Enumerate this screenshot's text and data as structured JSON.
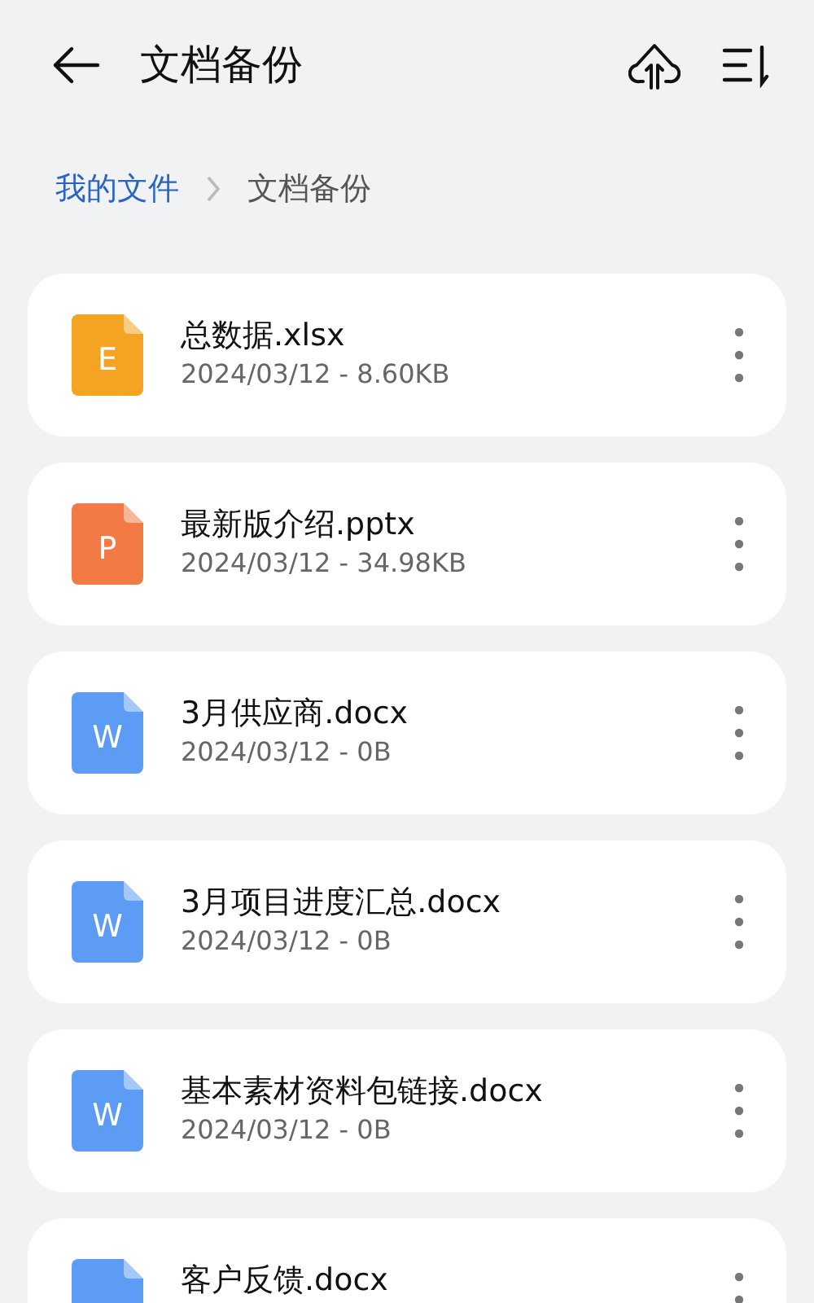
{
  "header": {
    "title": "文档备份"
  },
  "breadcrumb": [
    {
      "label": "我的文件",
      "current": false
    },
    {
      "label": "文档备份",
      "current": true
    }
  ],
  "files": [
    {
      "kind": "excel",
      "letter": "E",
      "name": "总数据.xlsx",
      "meta": "2024/03/12 - 8.60KB"
    },
    {
      "kind": "powerpoint",
      "letter": "P",
      "name": "最新版介绍.pptx",
      "meta": "2024/03/12 - 34.98KB"
    },
    {
      "kind": "word",
      "letter": "W",
      "name": "3月供应商.docx",
      "meta": "2024/03/12 - 0B"
    },
    {
      "kind": "word",
      "letter": "W",
      "name": "3月项目进度汇总.docx",
      "meta": "2024/03/12 - 0B"
    },
    {
      "kind": "word",
      "letter": "W",
      "name": "基本素材资料包链接.docx",
      "meta": "2024/03/12 - 0B"
    },
    {
      "kind": "word",
      "name": "客户反馈.docx"
    }
  ]
}
